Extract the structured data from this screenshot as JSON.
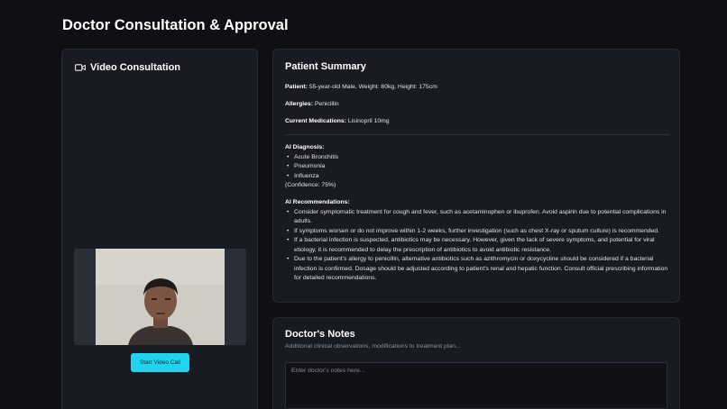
{
  "page": {
    "title": "Doctor Consultation & Approval"
  },
  "video": {
    "title": "Video Consultation",
    "start_label": "Start Video Call"
  },
  "summary": {
    "title": "Patient Summary",
    "patient_label": "Patient:",
    "patient_value": "55-year-old Male, Weight: 80kg, Height: 175cm",
    "allergies_label": "Allergies:",
    "allergies_value": "Penicillin",
    "meds_label": "Current Medications:",
    "meds_value": "Lisinopril 10mg",
    "diagnosis_label": "AI Diagnosis:",
    "diagnoses": [
      "Acute Bronchitis",
      "Pneumonia",
      "Influenza"
    ],
    "confidence": "(Confidence: 75%)",
    "recommendations_label": "AI Recommendations:",
    "recommendations": [
      "Consider symptomatic treatment for cough and fever, such as acetaminophen or ibuprofen. Avoid aspirin due to potential complications in adults.",
      "If symptoms worsen or do not improve within 1-2 weeks, further investigation (such as chest X-ray or sputum culture) is recommended.",
      "If a bacterial infection is suspected, antibiotics may be necessary. However, given the lack of severe symptoms, and potential for viral etiology, it is recommended to delay the prescription of antibiotics to avoid antibiotic resistance.",
      "Due to the patient's allergy to penicillin, alternative antibiotics such as azithromycin or doxycycline should be considered if a bacterial infection is confirmed. Dosage should be adjusted according to patient's renal and hepatic function. Consult official prescribing information for detailed recommendations."
    ]
  },
  "notes": {
    "title": "Doctor's Notes",
    "subtitle": "Additional clinical observations, modifications to treatment plan...",
    "placeholder": "Enter doctor's notes here...",
    "value": ""
  },
  "colors": {
    "background": "#0e1014",
    "card": "#181b22",
    "accent": "#22d3ee"
  },
  "icons": {
    "video": "video-camera-icon",
    "resize": "resize-grip-icon"
  }
}
